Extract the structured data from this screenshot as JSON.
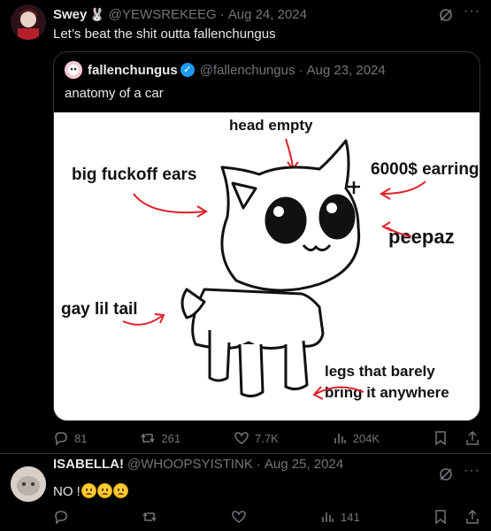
{
  "tweet1": {
    "name": "Swey",
    "badge": "🐰",
    "handle": "@YEWSREKEEG",
    "date": "Aug 24, 2024",
    "text": "Let’s beat the shit outta fallenchungus",
    "quote": {
      "name": "fallenchungus",
      "verified_mark": "✓",
      "handle": "@fallenchungus",
      "date": "Aug 23, 2024",
      "text": "anatomy of a car",
      "image_labels": {
        "head": "head empty",
        "ears": "big fuckoff ears",
        "earring": "6000$ earring",
        "eyes": "peepaz",
        "tail": "gay lil tail",
        "legs1": "legs that barely",
        "legs2": "bring it anywhere"
      }
    },
    "actions": {
      "replies": "81",
      "reposts": "261",
      "likes": "7.7K",
      "views": "204K"
    }
  },
  "tweet2": {
    "name": "ISABELLA!",
    "handle": "@WHOOPSYISTINK",
    "date": "Aug 25, 2024",
    "text": "NO !",
    "actions": {
      "views": "141"
    }
  },
  "separator": "·",
  "more_glyph": "···",
  "colors": {
    "background": "#000000",
    "text": "#e7e9ea",
    "muted": "#71767b",
    "border": "#2f3336",
    "verified": "#1d9bf0"
  }
}
